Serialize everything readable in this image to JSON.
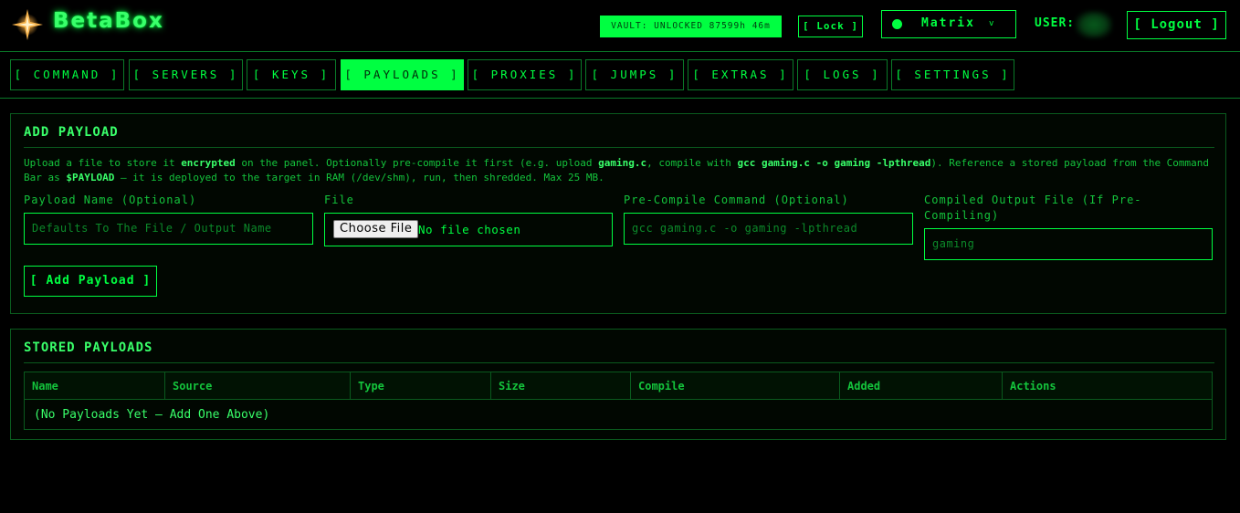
{
  "header": {
    "brand": "BetaBox",
    "vault_status": "VAULT: UNLOCKED 87599h 46m",
    "lock_label": "[ Lock ]",
    "theme": "Matrix",
    "theme_caret": "v",
    "user_label": "USER:",
    "logout_label": "[ Logout ]"
  },
  "nav": {
    "tabs": [
      {
        "label": "[ COMMAND ]"
      },
      {
        "label": "[ SERVERS ]"
      },
      {
        "label": "[ KEYS ]"
      },
      {
        "label": "[ PAYLOADS ]"
      },
      {
        "label": "[ PROXIES ]"
      },
      {
        "label": "[ JUMPS ]"
      },
      {
        "label": "[ EXTRAS ]"
      },
      {
        "label": "[ LOGS ]"
      },
      {
        "label": "[ SETTINGS ]"
      }
    ],
    "active": "[ PAYLOADS ]"
  },
  "add_payload": {
    "title": "ADD PAYLOAD",
    "desc": {
      "t1": "Upload a file to store it ",
      "b1": "encrypted",
      "t2": " on the panel. Optionally pre-compile it first (e.g. upload ",
      "b2": "gaming.c",
      "t3": ", compile with ",
      "b3": "gcc gaming.c -o gaming -lpthread",
      "t4": "). Reference a stored payload from the Command Bar as ",
      "b4": "$PAYLOAD",
      "t5": " – it is deployed to the target in RAM (/dev/shm), run, then shredded. Max 25 MB."
    },
    "fields": {
      "name_label": "Payload Name (Optional)",
      "name_placeholder": "Defaults To The File / Output Name",
      "file_label": "File",
      "file_button": "Choose File",
      "file_status": "No file chosen",
      "compile_label": "Pre-Compile Command (Optional)",
      "compile_placeholder": "gcc gaming.c -o gaming -lpthread",
      "output_label": "Compiled Output File (If Pre-Compiling)",
      "output_placeholder": "gaming"
    },
    "add_button": "[ Add Payload ]"
  },
  "stored_payloads": {
    "title": "STORED PAYLOADS",
    "columns": [
      "Name",
      "Source",
      "Type",
      "Size",
      "Compile",
      "Added",
      "Actions"
    ],
    "empty_message": "(No Payloads Yet – Add One Above)"
  }
}
